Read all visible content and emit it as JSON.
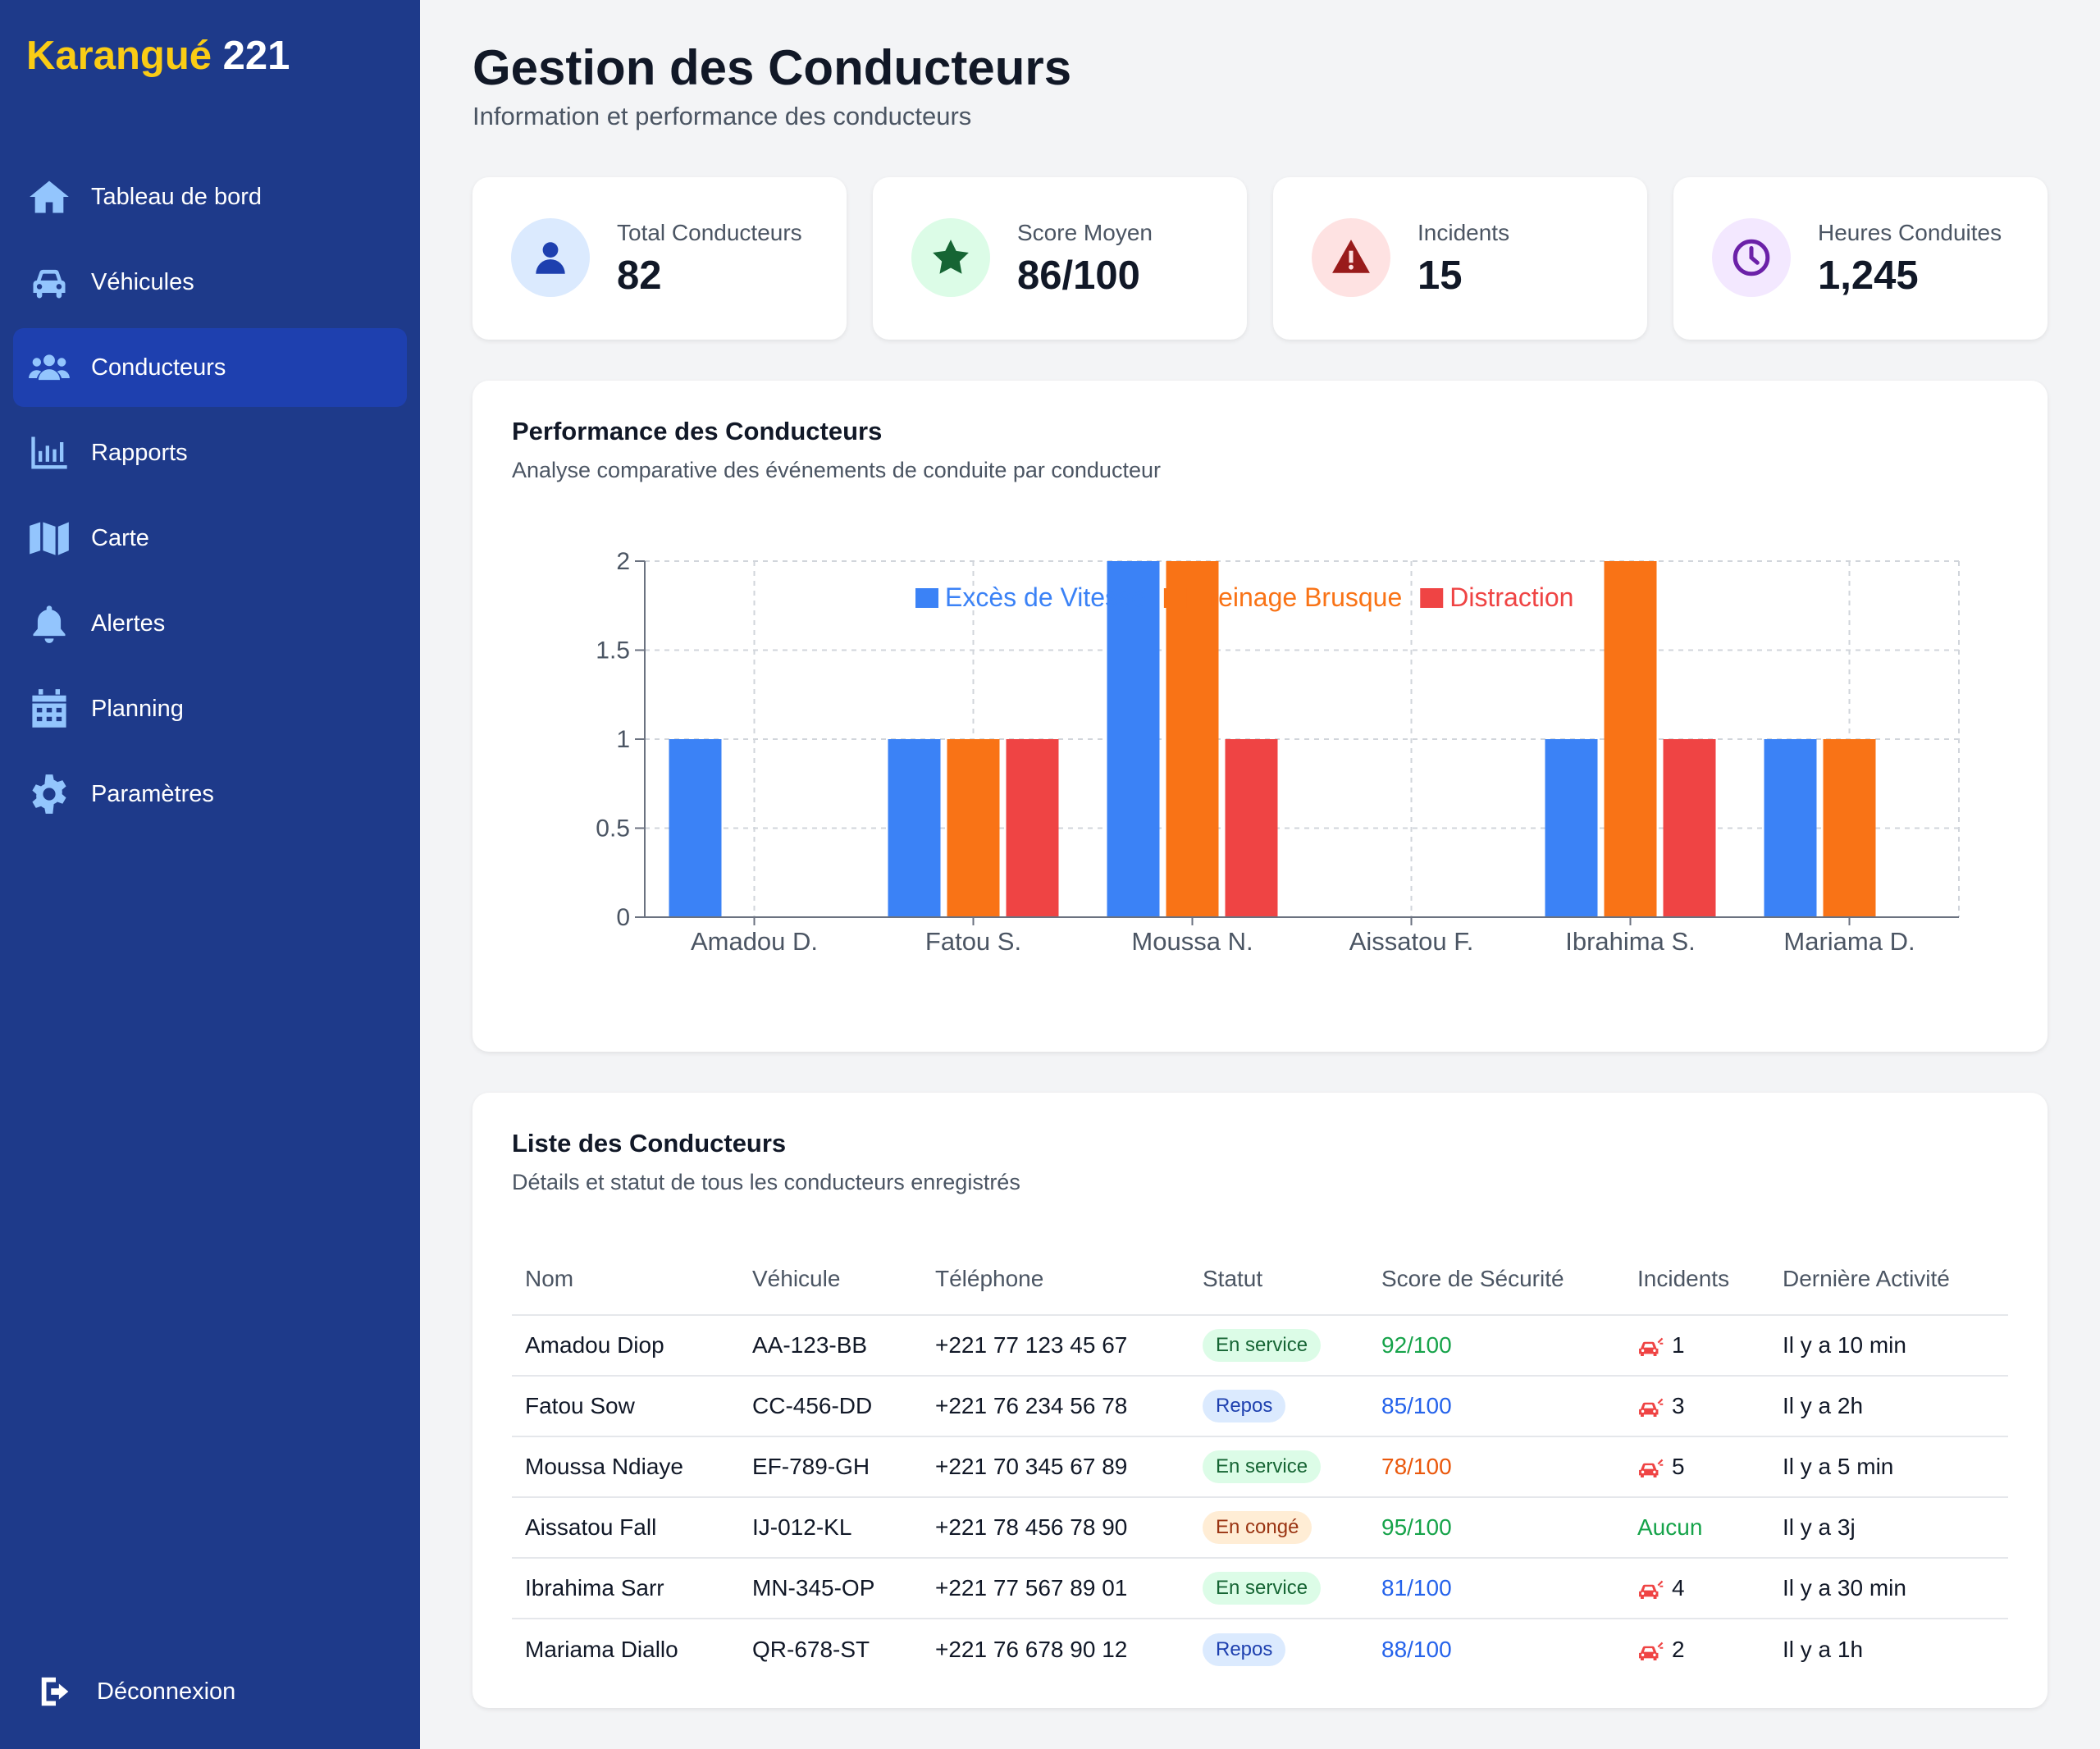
{
  "brand": {
    "part1": "Karangué",
    "part2": "221"
  },
  "sidebar": {
    "items": [
      {
        "label": "Tableau de bord",
        "icon": "home-icon",
        "active": false
      },
      {
        "label": "Véhicules",
        "icon": "car-icon",
        "active": false
      },
      {
        "label": "Conducteurs",
        "icon": "users-icon",
        "active": true
      },
      {
        "label": "Rapports",
        "icon": "bar-chart-icon",
        "active": false
      },
      {
        "label": "Carte",
        "icon": "map-icon",
        "active": false
      },
      {
        "label": "Alertes",
        "icon": "bell-icon",
        "active": false
      },
      {
        "label": "Planning",
        "icon": "calendar-icon",
        "active": false
      },
      {
        "label": "Paramètres",
        "icon": "gear-icon",
        "active": false
      }
    ],
    "logout": "Déconnexion"
  },
  "header": {
    "title": "Gestion des Conducteurs",
    "subtitle": "Information et performance des conducteurs"
  },
  "stats": [
    {
      "label": "Total Conducteurs",
      "value": "82",
      "icon": "user-icon",
      "bg": "#dbeafe",
      "fg": "#1e40af"
    },
    {
      "label": "Score Moyen",
      "value": "86/100",
      "icon": "star-icon",
      "bg": "#dcfce7",
      "fg": "#166534"
    },
    {
      "label": "Incidents",
      "value": "15",
      "icon": "warning-icon",
      "bg": "#fee2e2",
      "fg": "#991b1b"
    },
    {
      "label": "Heures Conduites",
      "value": "1,245",
      "icon": "clock-icon",
      "bg": "#f3e8ff",
      "fg": "#6b21a8"
    }
  ],
  "chart_section": {
    "title": "Performance des Conducteurs",
    "subtitle": "Analyse comparative des événements de conduite par conducteur"
  },
  "chart_data": {
    "type": "bar",
    "categories": [
      "Amadou D.",
      "Fatou S.",
      "Moussa N.",
      "Aissatou F.",
      "Ibrahima S.",
      "Mariama D."
    ],
    "series": [
      {
        "name": "Excès de Vitesse",
        "color": "#3b82f6",
        "values": [
          1,
          1,
          2,
          0,
          1,
          1
        ]
      },
      {
        "name": "Freinage Brusque",
        "color": "#f97316",
        "values": [
          0,
          1,
          2,
          0,
          2,
          1
        ]
      },
      {
        "name": "Distraction",
        "color": "#ef4444",
        "values": [
          0,
          1,
          1,
          0,
          1,
          0
        ]
      }
    ],
    "yticks": [
      "0",
      "0.5",
      "1",
      "1.5",
      "2"
    ],
    "ylim": [
      0,
      2
    ],
    "grid": true,
    "legend": "bottom"
  },
  "table_section": {
    "title": "Liste des Conducteurs",
    "subtitle": "Détails et statut de tous les conducteurs enregistrés",
    "columns": [
      "Nom",
      "Véhicule",
      "Téléphone",
      "Statut",
      "Score de Sécurité",
      "Incidents",
      "Dernière Activité"
    ],
    "rows": [
      {
        "name": "Amadou Diop",
        "vehicle": "AA-123-BB",
        "phone": "+221 77 123 45 67",
        "status": "En service",
        "status_type": "service",
        "score": "92/100",
        "score_color": "#16a34a",
        "incidents": "1",
        "has_icon": true,
        "incidents_color": "#111827",
        "last": "Il y a 10 min"
      },
      {
        "name": "Fatou Sow",
        "vehicle": "CC-456-DD",
        "phone": "+221 76 234 56 78",
        "status": "Repos",
        "status_type": "repos",
        "score": "85/100",
        "score_color": "#2563eb",
        "incidents": "3",
        "has_icon": true,
        "incidents_color": "#111827",
        "last": "Il y a 2h"
      },
      {
        "name": "Moussa Ndiaye",
        "vehicle": "EF-789-GH",
        "phone": "+221 70 345 67 89",
        "status": "En service",
        "status_type": "service",
        "score": "78/100",
        "score_color": "#ea580c",
        "incidents": "5",
        "has_icon": true,
        "incidents_color": "#111827",
        "last": "Il y a 5 min"
      },
      {
        "name": "Aissatou Fall",
        "vehicle": "IJ-012-KL",
        "phone": "+221 78 456 78 90",
        "status": "En congé",
        "status_type": "conge",
        "score": "95/100",
        "score_color": "#16a34a",
        "incidents": "Aucun",
        "has_icon": false,
        "incidents_color": "#16a34a",
        "last": "Il y a 3j"
      },
      {
        "name": "Ibrahima Sarr",
        "vehicle": "MN-345-OP",
        "phone": "+221 77 567 89 01",
        "status": "En service",
        "status_type": "service",
        "score": "81/100",
        "score_color": "#2563eb",
        "incidents": "4",
        "has_icon": true,
        "incidents_color": "#111827",
        "last": "Il y a 30 min"
      },
      {
        "name": "Mariama Diallo",
        "vehicle": "QR-678-ST",
        "phone": "+221 76 678 90 12",
        "status": "Repos",
        "status_type": "repos",
        "score": "88/100",
        "score_color": "#2563eb",
        "incidents": "2",
        "has_icon": true,
        "incidents_color": "#111827",
        "last": "Il y a 1h"
      }
    ]
  }
}
